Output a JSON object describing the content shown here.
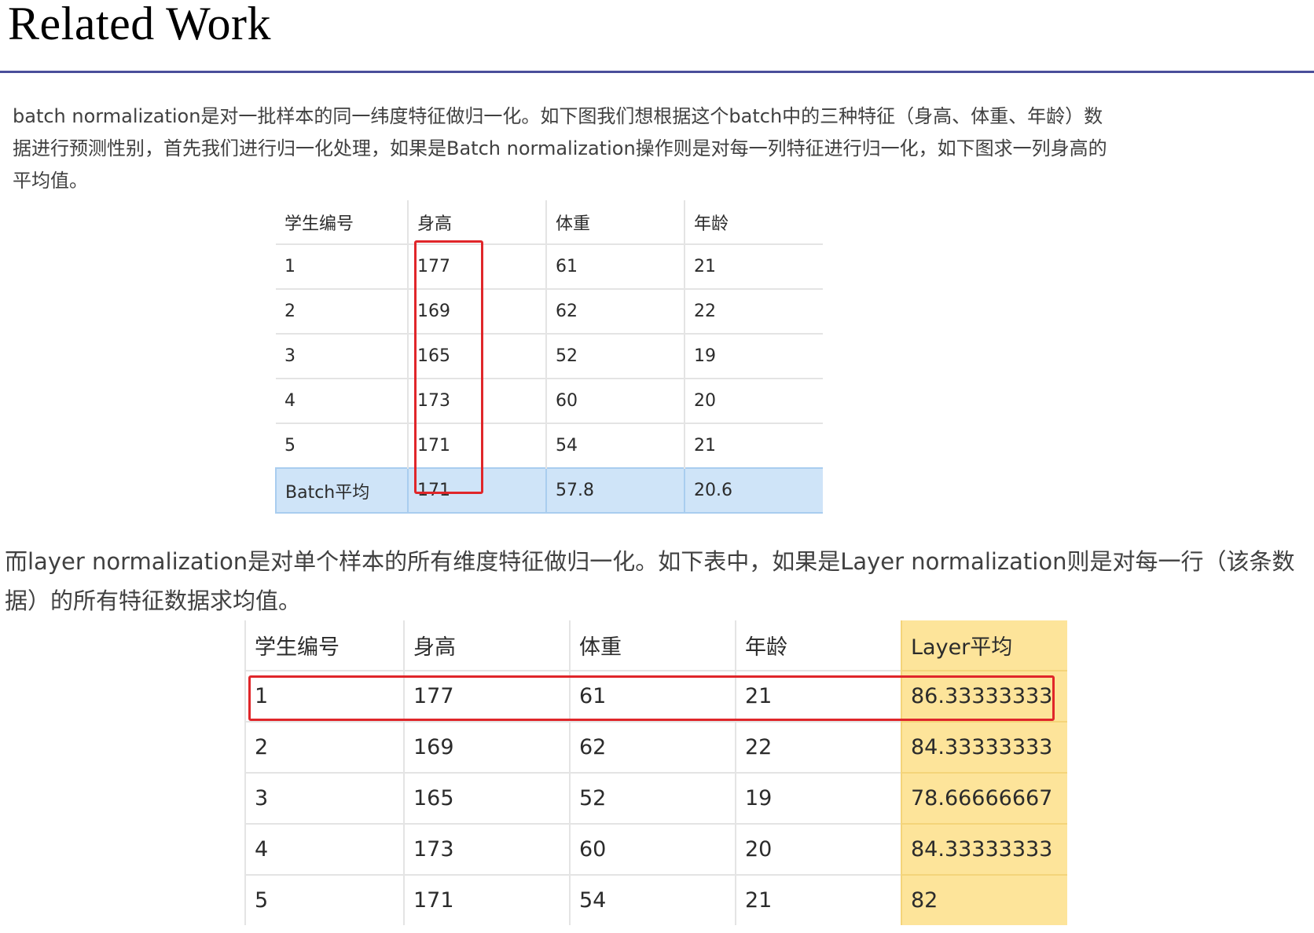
{
  "title": "Related Work",
  "para1": "batch normalization是对一批样本的同一纬度特征做归一化。如下图我们想根据这个batch中的三种特征（身高、体重、年龄）数据进行预测性别，首先我们进行归一化处理，如果是Batch normalization操作则是对每一列特征进行归一化，如下图求一列身高的平均值。",
  "table1": {
    "headers": [
      "学生编号",
      "身高",
      "体重",
      "年龄"
    ],
    "rows": [
      [
        "1",
        "177",
        "61",
        "21"
      ],
      [
        "2",
        "169",
        "62",
        "22"
      ],
      [
        "3",
        "165",
        "52",
        "19"
      ],
      [
        "4",
        "173",
        "60",
        "20"
      ],
      [
        "5",
        "171",
        "54",
        "21"
      ]
    ],
    "avg_row": [
      "Batch平均",
      "171",
      "57.8",
      "20.6"
    ]
  },
  "para2": "而layer normalization是对单个样本的所有维度特征做归一化。如下表中，如果是Layer normalization则是对每一行（该条数据）的所有特征数据求均值。",
  "table2": {
    "headers": [
      "学生编号",
      "身高",
      "体重",
      "年龄",
      "Layer平均"
    ],
    "rows": [
      [
        "1",
        "177",
        "61",
        "21",
        "86.33333333"
      ],
      [
        "2",
        "169",
        "62",
        "22",
        "84.33333333"
      ],
      [
        "3",
        "165",
        "52",
        "19",
        "78.66666667"
      ],
      [
        "4",
        "173",
        "60",
        "20",
        "84.33333333"
      ],
      [
        "5",
        "171",
        "54",
        "21",
        "82"
      ]
    ]
  },
  "colors": {
    "title_rule": "#4a4e9a",
    "highlight_box": "#e0262a",
    "batch_avg_fill": "#cfe4f8",
    "layer_avg_fill": "#fde49a"
  }
}
